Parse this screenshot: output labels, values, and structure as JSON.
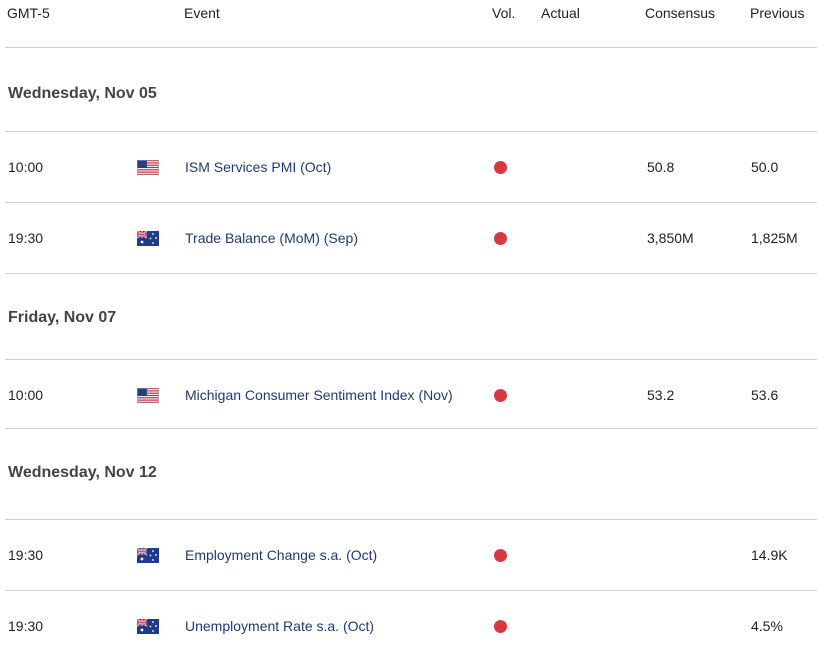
{
  "header": {
    "timezone": "GMT-5",
    "event": "Event",
    "vol": "Vol.",
    "actual": "Actual",
    "consensus": "Consensus",
    "previous": "Previous"
  },
  "colors": {
    "high_volatility": "#d63a40",
    "event_link": "#1f3a73"
  },
  "days": [
    {
      "label": "Wednesday, Nov 05",
      "events": [
        {
          "time": "10:00",
          "flag_icon": "us-flag-icon",
          "name": "ISM Services PMI (Oct)",
          "actual": "",
          "consensus": "50.8",
          "previous": "50.0"
        },
        {
          "time": "19:30",
          "flag_icon": "au-flag-icon",
          "name": "Trade Balance (MoM) (Sep)",
          "actual": "",
          "consensus": "3,850M",
          "previous": "1,825M"
        }
      ]
    },
    {
      "label": "Friday, Nov 07",
      "events": [
        {
          "time": "10:00",
          "flag_icon": "us-flag-icon",
          "name": "Michigan Consumer Sentiment Index (Nov)",
          "actual": "",
          "consensus": "53.2",
          "previous": "53.6"
        }
      ]
    },
    {
      "label": "Wednesday, Nov 12",
      "events": [
        {
          "time": "19:30",
          "flag_icon": "au-flag-icon",
          "name": "Employment Change s.a. (Oct)",
          "actual": "",
          "consensus": "",
          "previous": "14.9K"
        },
        {
          "time": "19:30",
          "flag_icon": "au-flag-icon",
          "name": "Unemployment Rate s.a. (Oct)",
          "actual": "",
          "consensus": "",
          "previous": "4.5%"
        }
      ]
    }
  ]
}
